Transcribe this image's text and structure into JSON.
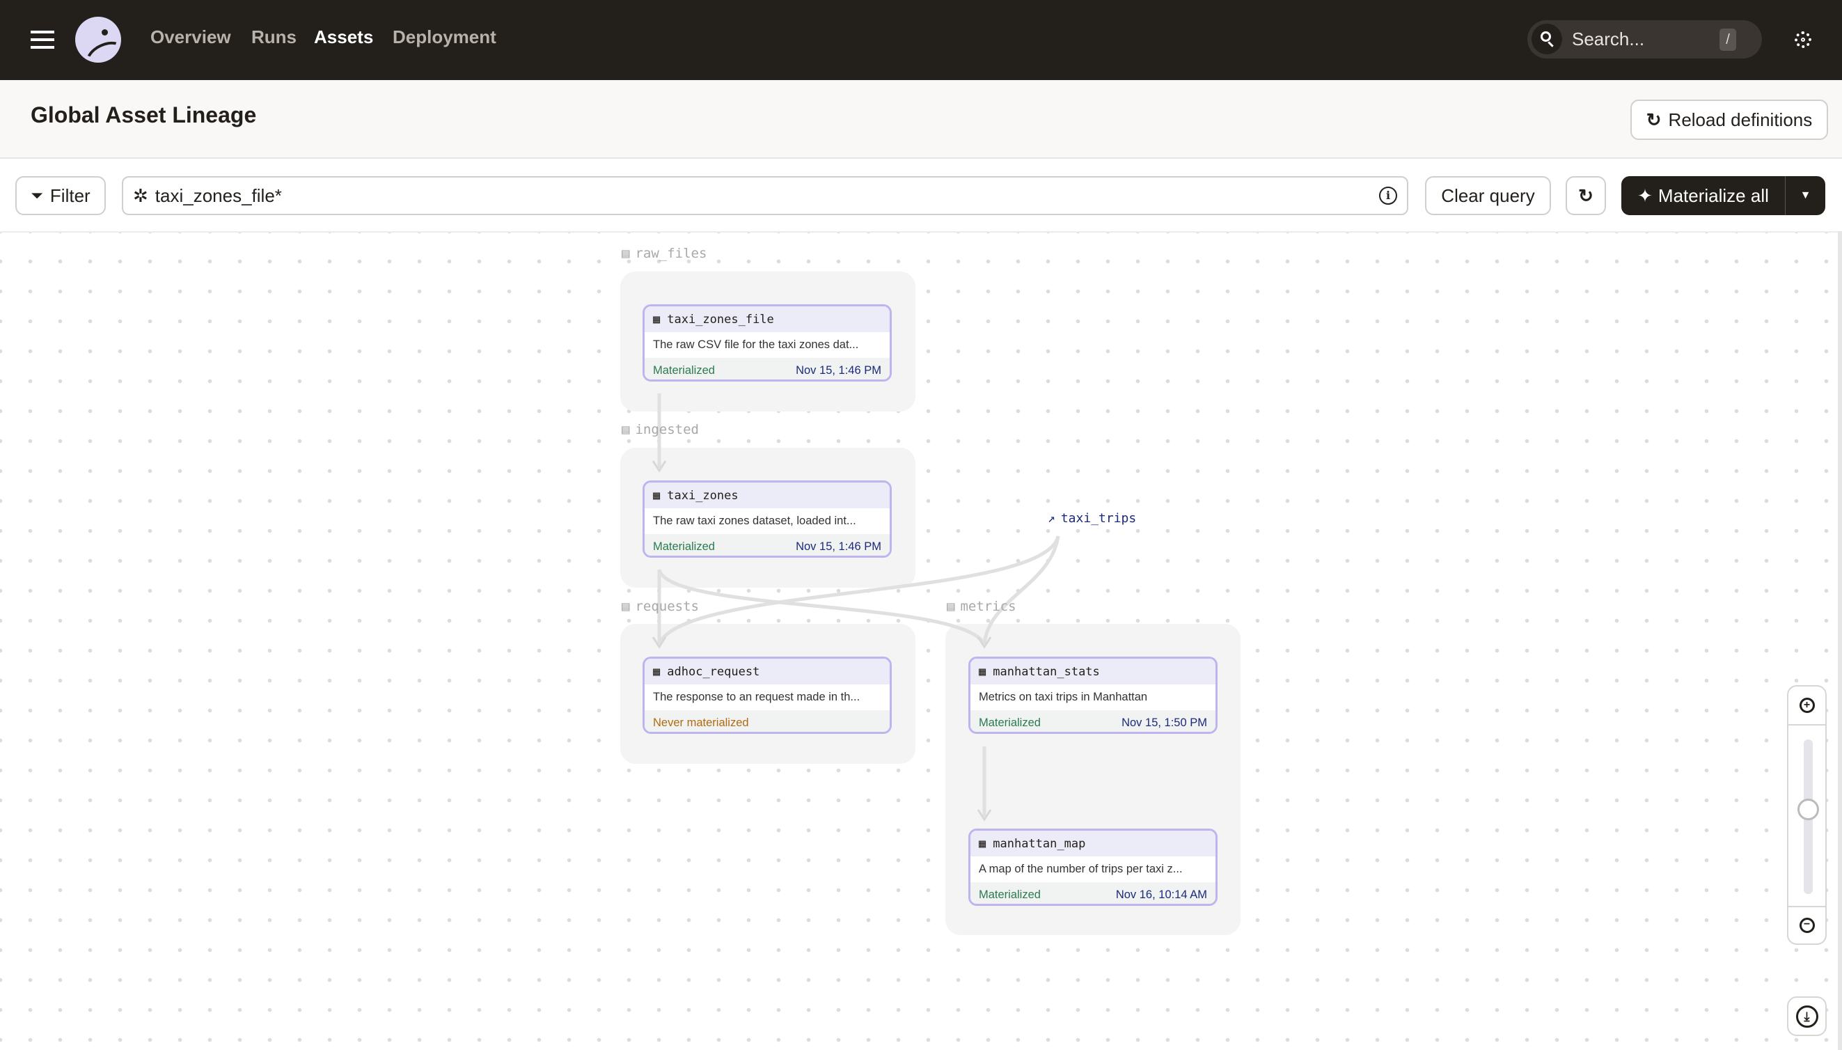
{
  "topbar": {
    "nav": [
      "Overview",
      "Runs",
      "Assets",
      "Deployment"
    ],
    "active": "Assets",
    "search_placeholder": "Search...",
    "search_shortcut": "/"
  },
  "page": {
    "title": "Global Asset Lineage",
    "reload_label": "Reload definitions"
  },
  "toolbar": {
    "filter_label": "Filter",
    "query_value": "taxi_zones_file*",
    "clear_label": "Clear query",
    "materialize_label": "Materialize all"
  },
  "groups": [
    {
      "name": "raw_files"
    },
    {
      "name": "ingested"
    },
    {
      "name": "requests"
    },
    {
      "name": "metrics"
    }
  ],
  "nodes": [
    {
      "name": "taxi_zones_file",
      "description": "The raw CSV file for the taxi zones dat...",
      "status": "Materialized",
      "time": "Nov 15, 1:46 PM"
    },
    {
      "name": "taxi_zones",
      "description": "The raw taxi zones dataset, loaded int...",
      "status": "Materialized",
      "time": "Nov 15, 1:46 PM"
    },
    {
      "name": "adhoc_request",
      "description": "The response to an request made in th...",
      "status": "Never materialized",
      "time": ""
    },
    {
      "name": "manhattan_stats",
      "description": "Metrics on taxi trips in Manhattan",
      "status": "Materialized",
      "time": "Nov 15, 1:50 PM"
    },
    {
      "name": "manhattan_map",
      "description": "A map of the number of trips per taxi z...",
      "status": "Materialized",
      "time": "Nov 16, 10:14 AM"
    }
  ],
  "external_asset": {
    "name": "taxi_trips"
  },
  "zoom_level": 0.55,
  "colors": {
    "topbar": "#231f1b",
    "node_border": "#bdb4f0",
    "materialized": "#2b7a50",
    "never_materialized": "#b26a10",
    "link": "#1b2a7a"
  }
}
